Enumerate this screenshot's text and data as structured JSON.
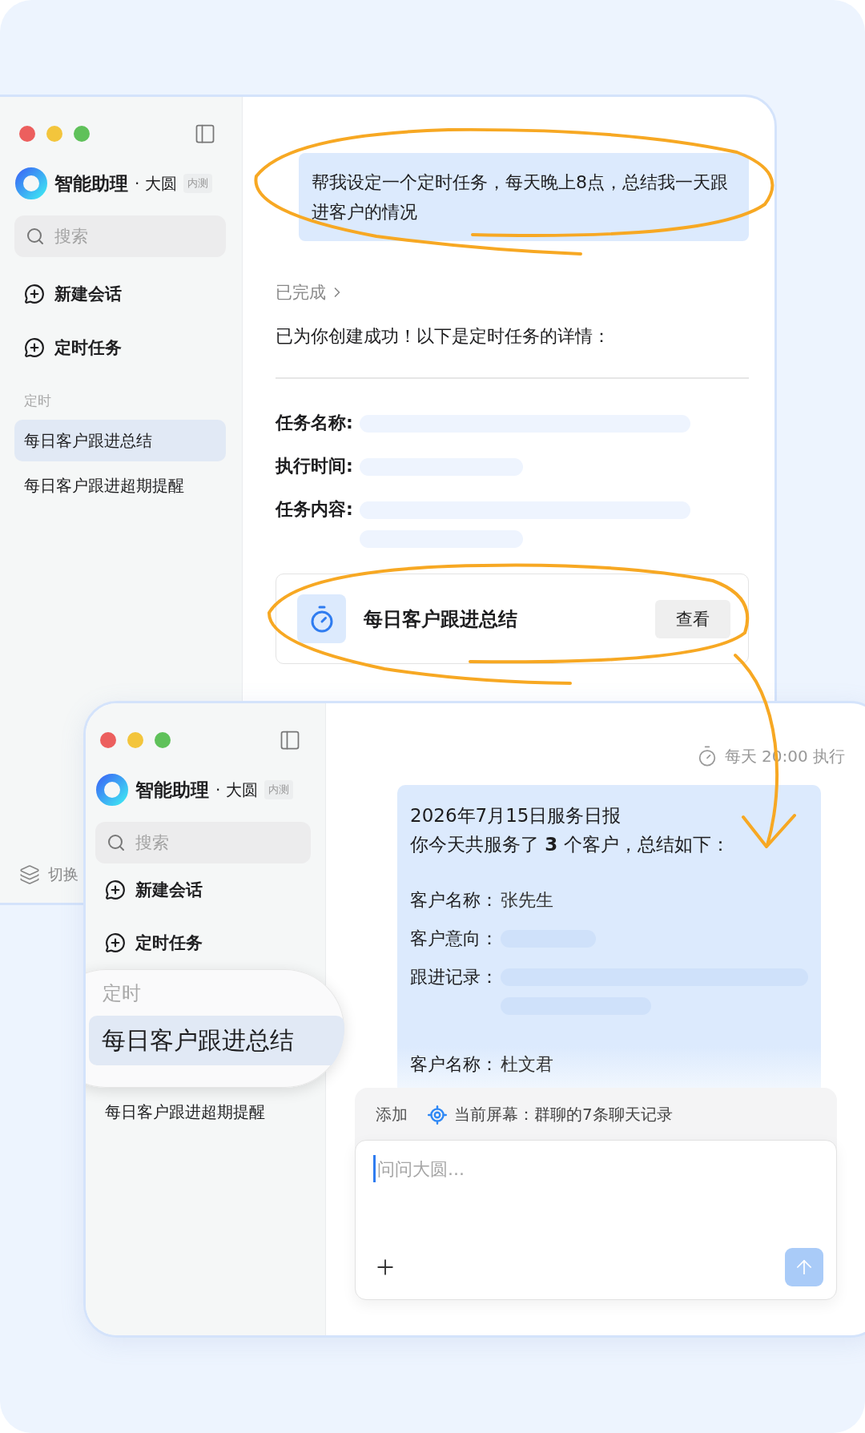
{
  "back_window": {
    "brand": {
      "name": "智能助理",
      "assistant": "· 大圆",
      "badge": "内测"
    },
    "search": {
      "placeholder": "搜索"
    },
    "nav": [
      {
        "label": "新建会话"
      },
      {
        "label": "定时任务"
      }
    ],
    "section": {
      "label": "定时",
      "items": [
        {
          "label": "每日客户跟进总结",
          "selected": true
        },
        {
          "label": "每日客户跟进超期提醒",
          "selected": false
        }
      ]
    },
    "footer": {
      "label": "切换"
    },
    "chat": {
      "user_message": "帮我设定一个定时任务，每天晚上8点，总结我一天跟进客户的情况",
      "status": "已完成",
      "reply": "已为你创建成功！以下是定时任务的详情：",
      "details": [
        {
          "label": "任务名称:"
        },
        {
          "label": "执行时间:"
        },
        {
          "label": "任务内容:"
        }
      ],
      "task_card": {
        "title": "每日客户跟进总结",
        "button": "查看"
      }
    }
  },
  "front_window": {
    "brand": {
      "name": "智能助理",
      "assistant": "· 大圆",
      "badge": "内测"
    },
    "search": {
      "placeholder": "搜索"
    },
    "nav": [
      {
        "label": "新建会话"
      },
      {
        "label": "定时任务"
      }
    ],
    "section": {
      "label": "定时",
      "magnified": true,
      "items": [
        {
          "label": "每日客户跟进总结",
          "selected": true
        },
        {
          "label": "每日客户跟进超期提醒",
          "selected": false
        }
      ]
    },
    "chat": {
      "schedule_note": "每天 20:00 执行",
      "report": {
        "title": "2026年7月15日服务日报",
        "summary": "你今天共服务了 **3** 个客户，总结如下：",
        "customers": [
          {
            "fields": [
              {
                "label": "客户名称：",
                "value": "张先生"
              },
              {
                "label": "客户意向："
              },
              {
                "label": "跟进记录："
              }
            ]
          },
          {
            "fields": [
              {
                "label": "客户名称：",
                "value": "杜文君"
              }
            ]
          }
        ]
      },
      "composer": {
        "add": "添加",
        "context": "当前屏幕：群聊的7条聊天记录",
        "placeholder": "问问大圆..."
      }
    }
  }
}
